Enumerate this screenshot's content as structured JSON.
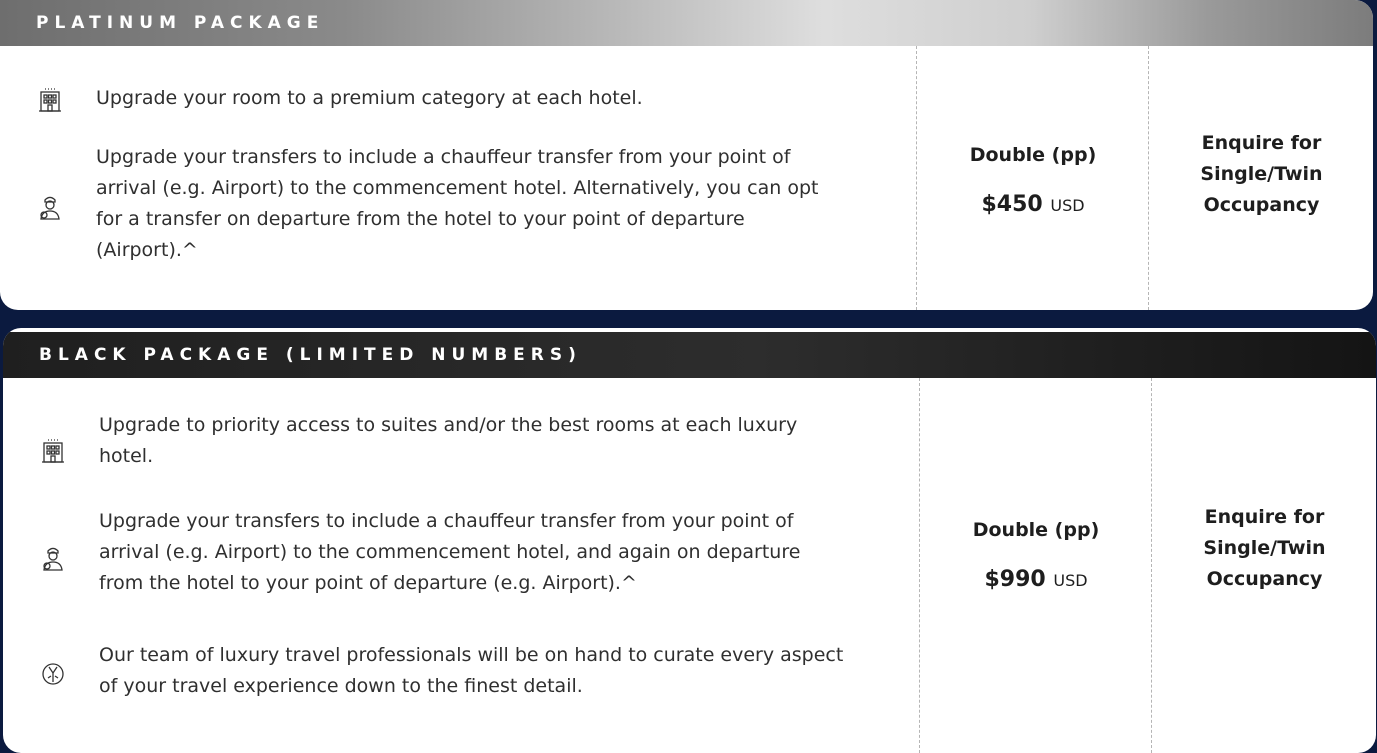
{
  "platinum": {
    "title": "PLATINUM PACKAGE",
    "features": [
      {
        "icon": "hotel-icon",
        "text": "Upgrade your room to a premium category at each hotel."
      },
      {
        "icon": "chauffeur-icon",
        "text": "Upgrade your transfers to include a chauffeur transfer from your point of arrival (e.g. Airport) to the commencement hotel. Alternatively, you can opt for a transfer on departure from the hotel to your point of departure (Airport).^"
      }
    ],
    "occupancy_label": "Double (pp)",
    "price": "$450",
    "currency": "USD",
    "enquire": "Enquire for Single/Twin Occupancy"
  },
  "black": {
    "title": "BLACK PACKAGE (LIMITED NUMBERS)",
    "features": [
      {
        "icon": "hotel-icon",
        "text": "Upgrade to priority access to suites and/or the best rooms at each luxury hotel."
      },
      {
        "icon": "chauffeur-icon",
        "text": "Upgrade your transfers to include a chauffeur transfer from your point of arrival (e.g. Airport) to the commencement hotel, and again on departure from the hotel to your point of departure (e.g. Airport).^"
      },
      {
        "icon": "concierge-icon",
        "text": "Our team of luxury travel professionals will be on hand to curate every aspect of your travel experience down to the finest detail."
      }
    ],
    "occupancy_label": "Double (pp)",
    "price": "$990",
    "currency": "USD",
    "enquire": "Enquire for Single/Twin Occupancy"
  }
}
